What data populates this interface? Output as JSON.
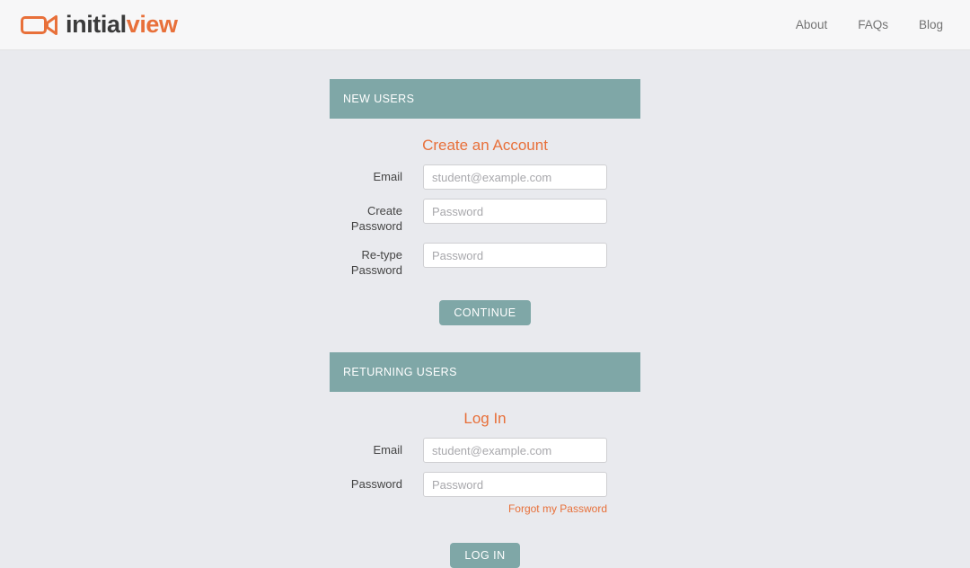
{
  "header": {
    "brand": {
      "icon": "video-camera-icon",
      "text_primary": "initial",
      "text_accent": "view"
    },
    "nav": [
      {
        "label": "About"
      },
      {
        "label": "FAQs"
      },
      {
        "label": "Blog"
      }
    ]
  },
  "new_users": {
    "bar_label": "NEW USERS",
    "title": "Create an Account",
    "email": {
      "label": "Email",
      "placeholder": "student@example.com",
      "value": ""
    },
    "create_password": {
      "label_line1": "Create",
      "label_line2": "Password",
      "placeholder": "Password",
      "value": ""
    },
    "retype_password": {
      "label_line1": "Re-type",
      "label_line2": "Password",
      "placeholder": "Password",
      "value": ""
    },
    "submit_label": "CONTINUE"
  },
  "returning_users": {
    "bar_label": "RETURNING USERS",
    "title": "Log In",
    "email": {
      "label": "Email",
      "placeholder": "student@example.com",
      "value": ""
    },
    "password": {
      "label": "Password",
      "placeholder": "Password",
      "value": ""
    },
    "forgot_password_label": "Forgot my Password",
    "submit_label": "LOG IN"
  },
  "colors": {
    "accent_orange": "#e8703a",
    "section_teal": "#7fa7a7",
    "page_background": "#e9eaee",
    "header_background": "#f7f7f8",
    "label_text": "#444444",
    "placeholder_text": "#a8a8ac",
    "nav_text": "#737373"
  }
}
